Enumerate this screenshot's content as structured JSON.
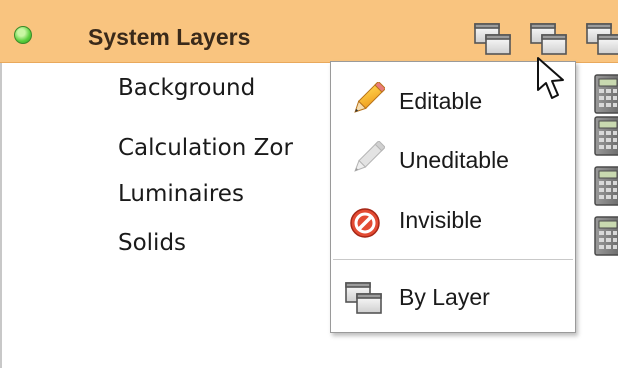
{
  "header": {
    "title": "System Layers",
    "bg_color": "#f9c47f",
    "status": "active",
    "icons": [
      "layer-mode-icon",
      "layer-mode-icon",
      "layer-mode-icon"
    ]
  },
  "layers": {
    "items": [
      {
        "label": "Background",
        "icon": "calculator-icon"
      },
      {
        "label": "Calculation Zor",
        "icon": "calculator-icon"
      },
      {
        "label": "Luminaires",
        "icon": "calculator-icon"
      },
      {
        "label": "Solids",
        "icon": "calculator-icon"
      }
    ]
  },
  "context_menu": {
    "items": [
      {
        "label": "Editable",
        "icon": "pencil-icon"
      },
      {
        "label": "Uneditable",
        "icon": "pencil-disabled-icon"
      },
      {
        "label": "Invisible",
        "icon": "no-entry-icon"
      }
    ],
    "by_layer": {
      "label": "By Layer",
      "icon": "layers-icon"
    }
  }
}
